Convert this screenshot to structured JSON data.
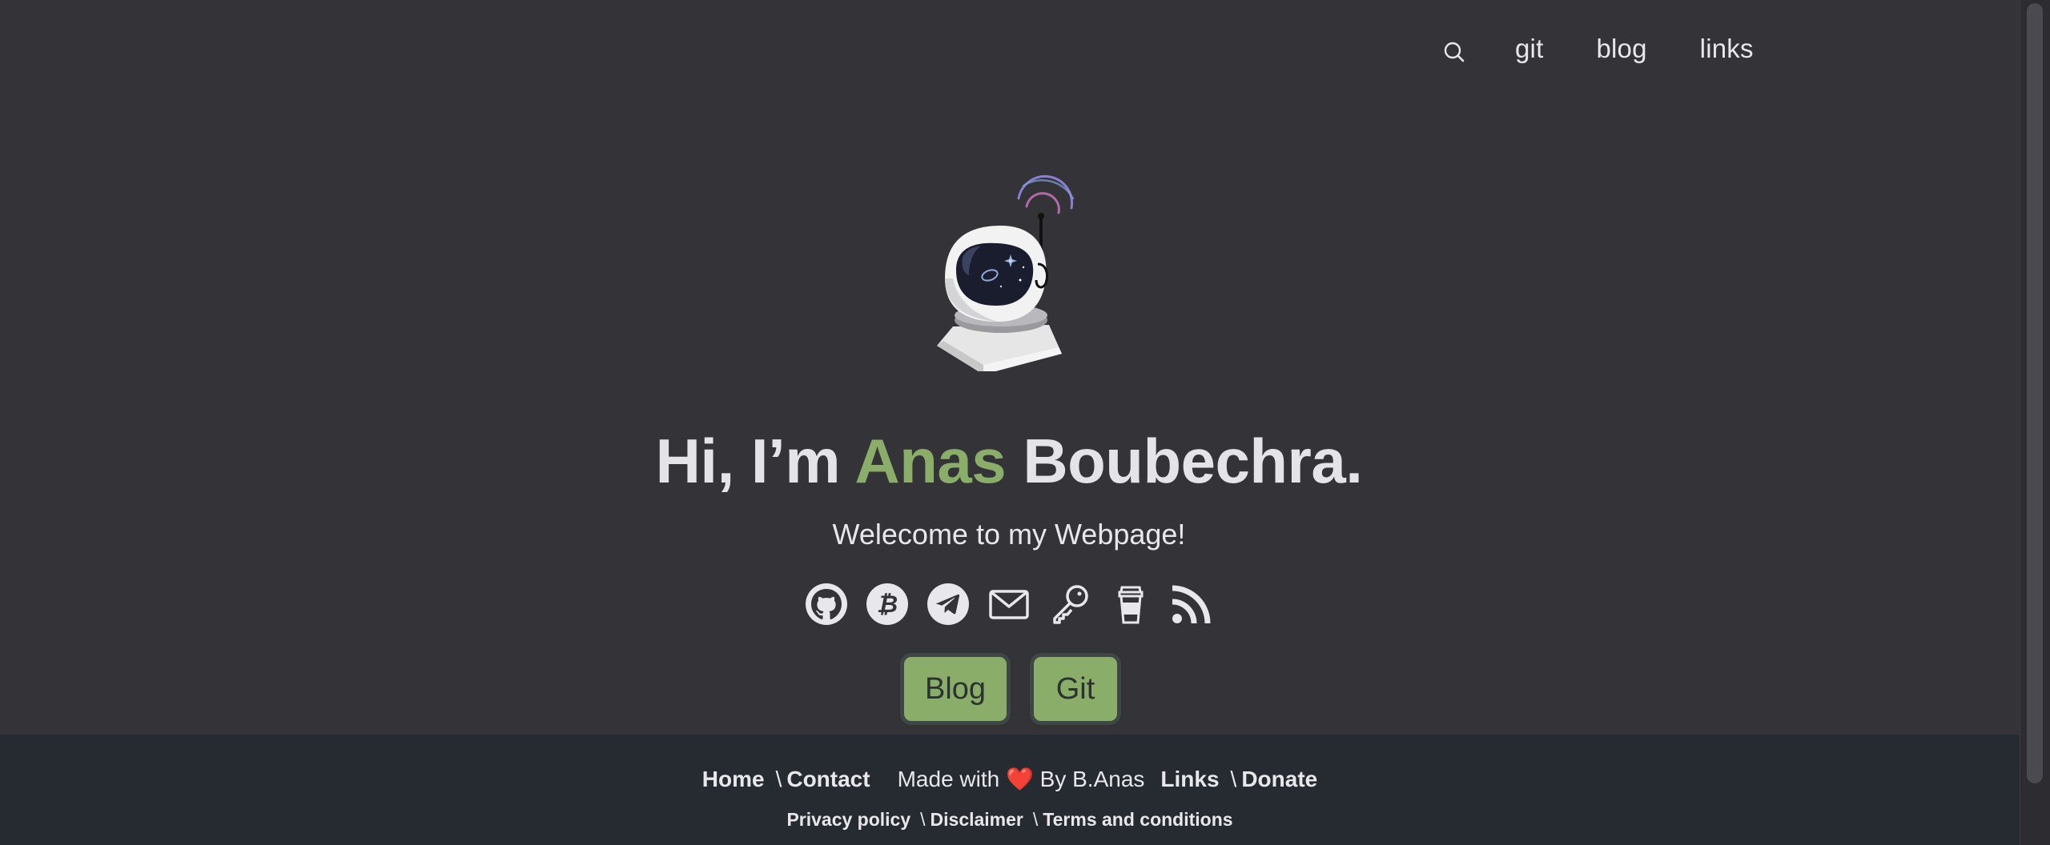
{
  "nav": {
    "search_icon": "search-icon",
    "links": [
      {
        "label": "git"
      },
      {
        "label": "blog"
      },
      {
        "label": "links"
      }
    ]
  },
  "hero": {
    "avatar_icon": "astronaut-helmet",
    "title_prefix": "Hi, I’m ",
    "title_accent": "Anas",
    "title_suffix": " Boubechra.",
    "subtitle": "Welecome to my Webpage!"
  },
  "socials": [
    {
      "icon": "github-icon"
    },
    {
      "icon": "bitcoin-icon"
    },
    {
      "icon": "telegram-icon"
    },
    {
      "icon": "mail-icon"
    },
    {
      "icon": "key-icon"
    },
    {
      "icon": "coffee-cup-icon"
    },
    {
      "icon": "rss-icon"
    }
  ],
  "buttons": {
    "blog": "Blog",
    "git": "Git"
  },
  "footer": {
    "home": "Home",
    "contact": "Contact",
    "made_prefix": "Made with",
    "heart": "❤️",
    "made_suffix": "By B.Anas",
    "links": "Links",
    "donate": "Donate",
    "privacy": "Privacy policy",
    "disclaimer": "Disclaimer",
    "terms": "Terms and conditions",
    "separator": "\\"
  },
  "colors": {
    "background": "#333338",
    "accent": "#8aad69",
    "footer_bg": "#262a31",
    "text": "#e8e8ec",
    "heart": "#d9362f"
  }
}
